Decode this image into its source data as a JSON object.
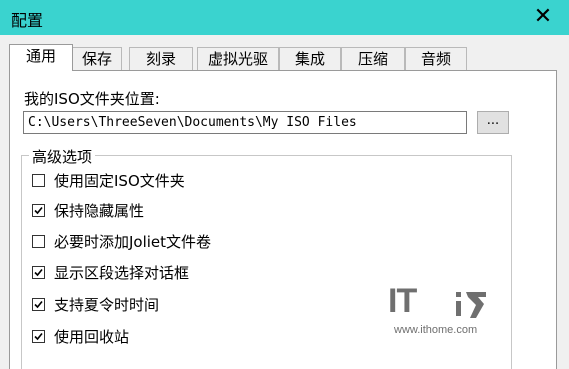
{
  "window": {
    "title": "配置",
    "close_glyph": "✕"
  },
  "tabs": [
    {
      "label": "通用",
      "active": true
    },
    {
      "label": "保存",
      "active": false
    },
    {
      "label": "刻录",
      "active": false
    },
    {
      "label": "虚拟光驱",
      "active": false
    },
    {
      "label": "集成",
      "active": false
    },
    {
      "label": "压缩",
      "active": false
    },
    {
      "label": "音频",
      "active": false
    }
  ],
  "iso_folder": {
    "label": "我的ISO文件夹位置:",
    "path": "C:\\Users\\ThreeSeven\\Documents\\My ISO Files",
    "browse_label": "..."
  },
  "advanced": {
    "title": "高级选项",
    "options": [
      {
        "label": "使用固定ISO文件夹",
        "checked": false
      },
      {
        "label": "保持隐藏属性",
        "checked": true
      },
      {
        "label": "必要时添加Joliet文件卷",
        "checked": false
      },
      {
        "label": "显示区段选择对话框",
        "checked": true
      },
      {
        "label": "支持夏令时时间",
        "checked": true
      },
      {
        "label": "使用回收站",
        "checked": true
      }
    ]
  },
  "watermark": {
    "logo": "IT",
    "url": "www.ithome.com"
  }
}
